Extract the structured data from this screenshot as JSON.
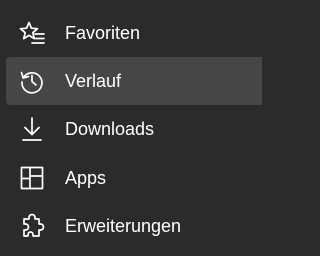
{
  "menu": {
    "items": [
      {
        "label": "Favoriten",
        "icon": "favorites-star-list-icon"
      },
      {
        "label": "Verlauf",
        "icon": "history-icon",
        "selected": true
      },
      {
        "label": "Downloads",
        "icon": "download-icon"
      },
      {
        "label": "Apps",
        "icon": "apps-grid-icon"
      },
      {
        "label": "Erweiterungen",
        "icon": "extensions-puzzle-icon"
      }
    ]
  },
  "colors": {
    "background": "#2b2b2b",
    "selected_background": "#464646",
    "text": "#ffffff"
  }
}
